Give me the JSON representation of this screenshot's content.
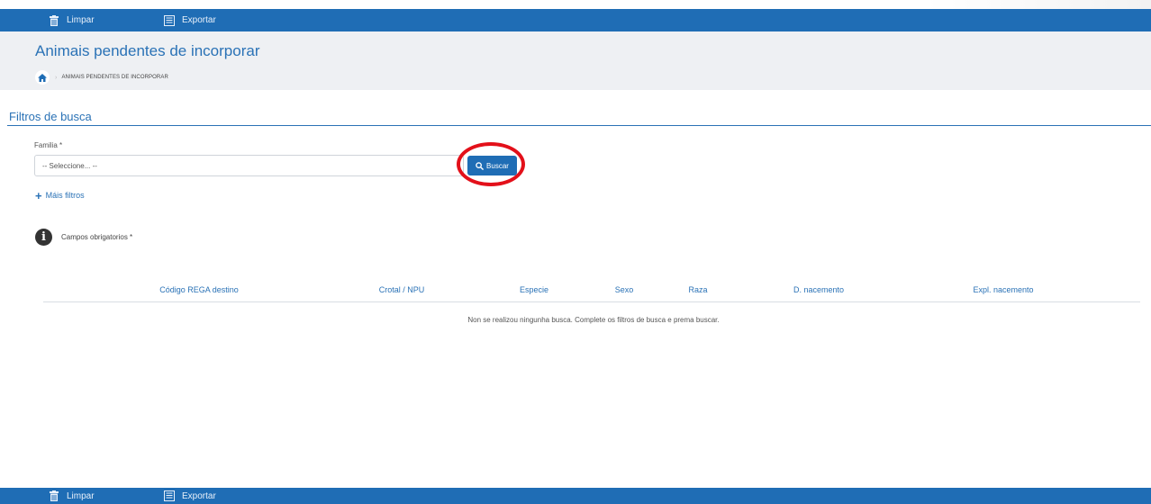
{
  "toolbar": {
    "clear_label": "Limpar",
    "export_label": "Exportar"
  },
  "header": {
    "title": "Animais pendentes de incorporar",
    "breadcrumb": "ANIMAIS PENDENTES DE INCORPORAR"
  },
  "filters": {
    "section_title": "Filtros de busca",
    "family_label": "Familia *",
    "family_selected": "-- Seleccione... --",
    "search_button": "Buscar",
    "more_filters": "Máis filtros",
    "required_note": "Campos obrigatorios *"
  },
  "table": {
    "columns": [
      "Código REGA destino",
      "Crotal / NPU",
      "Especie",
      "Sexo",
      "Raza",
      "D. nacemento",
      "Expl. nacemento"
    ],
    "empty_message": "Non se realizou ningunha busca. Complete os filtros de busca e prema buscar."
  },
  "colors": {
    "primary": "#1f6db5",
    "highlight_ring": "#e3101a"
  },
  "icons": {
    "clear": "trash-icon",
    "export": "document-icon",
    "home": "home-icon",
    "search": "search-icon",
    "info": "info-icon"
  }
}
